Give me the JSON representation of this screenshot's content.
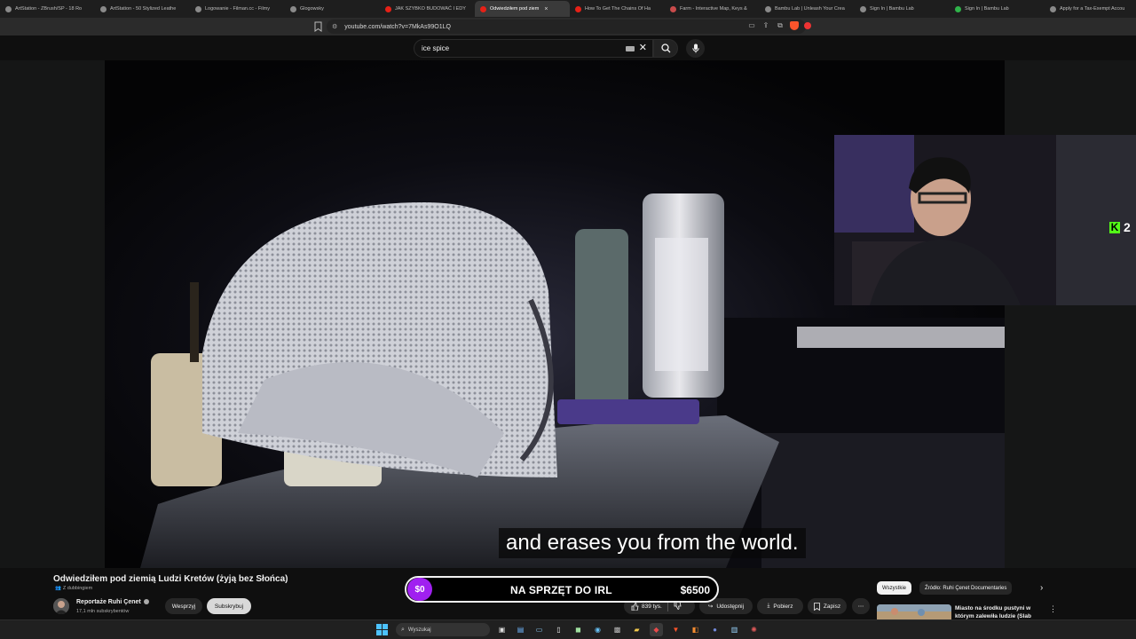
{
  "colors": {
    "youtube_bg": "#0f0f0f",
    "goal_accent": "#a020f0",
    "kick_green": "#53fc18",
    "taskbar_accent": "#4cc2ff"
  },
  "browser": {
    "tabs": [
      {
        "label": "ArtStation - ZBrush/SP - 18 Ro",
        "icon": "artstation-icon",
        "color": "#8a8a8a"
      },
      {
        "label": "ArtStation - 50 Stylized Leathe",
        "icon": "artstation-icon",
        "color": "#8a8a8a"
      },
      {
        "label": "Logowanie - Filman.cc - Filmy",
        "icon": "globe-icon",
        "color": "#8a8a8a"
      },
      {
        "label": "Glogowsky",
        "icon": "globe-icon",
        "color": "#8a8a8a"
      },
      {
        "label": "JAK SZYBKO BUDOWAĆ I EDY",
        "icon": "youtube-icon",
        "color": "#e62117"
      },
      {
        "label": "Odwiedziłem pod ziem",
        "icon": "youtube-icon",
        "color": "#e62117",
        "active": true,
        "close": "×"
      },
      {
        "label": "How To Get The Chains Of Ha",
        "icon": "youtube-icon",
        "color": "#e62117"
      },
      {
        "label": "Farm - Interactive Map, Keys &",
        "icon": "map-icon",
        "color": "#c94b4b"
      },
      {
        "label": "Bambu Lab | Unleash Your Crea",
        "icon": "globe-icon",
        "color": "#8a8a8a"
      },
      {
        "label": "Sign In | Bambu Lab",
        "icon": "globe-icon",
        "color": "#8a8a8a"
      },
      {
        "label": "Sign In | Bambu Lab",
        "icon": "bambu-icon",
        "color": "#2fb34a"
      },
      {
        "label": "Apply for a Tax-Exempt Accou",
        "icon": "globe-icon",
        "color": "#8a8a8a"
      }
    ],
    "url": "youtube.com/watch?v=7MkAs99O1LQ"
  },
  "youtube": {
    "search_value": "ice spice"
  },
  "overlay": {
    "caption": "and erases you from the world.",
    "kick_count": "2",
    "goal": {
      "current": "$0",
      "label": "NA SPRZĘT DO IRL",
      "target": "$6500",
      "progress": 0
    }
  },
  "video": {
    "title": "Odwiedziłem pod ziemią Ludzi Kretów (żyją bez Słońca)",
    "dubbing": "Z dubbingiem",
    "channel": "Reportaże Ruhi Çenet",
    "subscribers": "17,1 mln subskrybentów",
    "join_label": "Wesprzyj",
    "subscribe_label": "Subskrybuj",
    "likes": "839 tys.",
    "share_label": "Udostępnij",
    "download_label": "Pobierz",
    "save_label": "Zapisz",
    "more_label": "⋯"
  },
  "sidebar": {
    "chips": [
      "Wszystkie",
      "Źródło: Ruhi Çenet Documentaries"
    ],
    "next_label": "›",
    "rec_title": "Miasto na środku pustyni w którym zalewiła ludzie (Slab City)",
    "rec_more": "⋮"
  },
  "taskbar": {
    "search_placeholder": "Wyszukaj"
  }
}
